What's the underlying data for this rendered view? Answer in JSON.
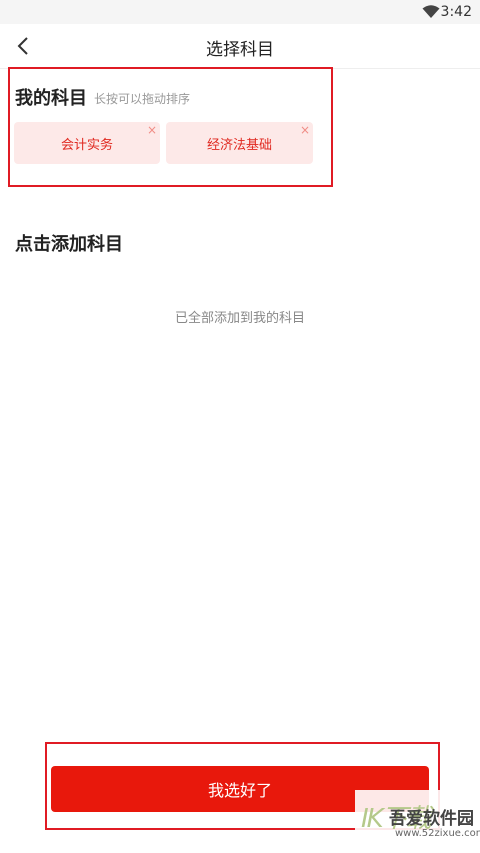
{
  "status_bar": {
    "time": "3:42",
    "wifi_icon": "wifi-icon"
  },
  "header": {
    "title": "选择科目",
    "back_icon": "chevron-left-icon"
  },
  "my_subjects": {
    "title": "我的科目",
    "hint": "长按可以拖动排序",
    "items": [
      {
        "label": "会计实务",
        "remove": "×"
      },
      {
        "label": "经济法基础",
        "remove": "×"
      }
    ]
  },
  "add_subjects": {
    "title": "点击添加科目",
    "empty_text": "已全部添加到我的科目"
  },
  "footer": {
    "confirm_label": "我选好了"
  },
  "watermark": {
    "logo": "IK下载",
    "title": "吾爱软件园",
    "url": "www.52zixue.com"
  },
  "colors": {
    "accent": "#e8180c",
    "chip_bg": "#fde9e8",
    "highlight": "#e01b24"
  }
}
